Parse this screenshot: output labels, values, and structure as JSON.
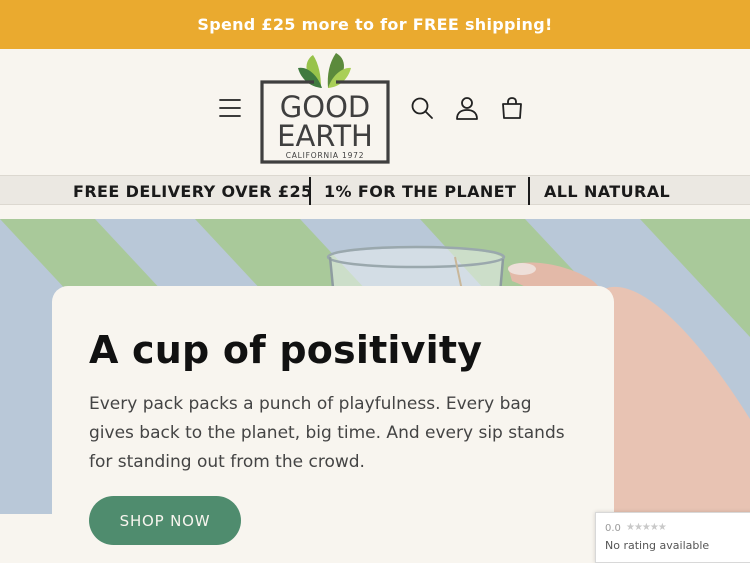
{
  "announcement": {
    "text": "Spend £25 more to for FREE shipping!"
  },
  "header": {
    "logo": {
      "line1": "GOOD",
      "line2": "EARTH",
      "line3": "CALIFORNIA 1972"
    },
    "icons": [
      "menu-icon",
      "search-icon",
      "account-icon",
      "cart-icon"
    ]
  },
  "features": [
    "FREE DELIVERY OVER £25",
    "1% FOR THE PLANET",
    "ALL NATURAL"
  ],
  "hero": {
    "title": "A cup of positivity",
    "body": "Every pack packs a punch of playfulness. Every bag gives back to the planet, big time. And every sip stands for standing out from the crowd.",
    "cta": "SHOP NOW"
  },
  "rating_badge": {
    "score": "0.0",
    "stars": "★★★★★",
    "note": "No rating available"
  },
  "colors": {
    "announcement_bg": "#eaaa2f",
    "page_bg": "#f8f5ef",
    "cta_bg": "#4f8c6e"
  }
}
